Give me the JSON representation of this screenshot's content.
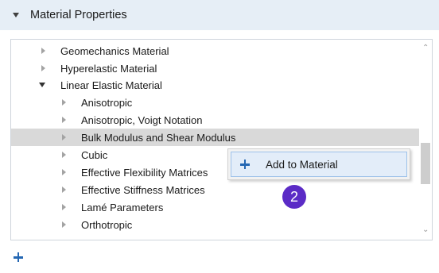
{
  "header": {
    "title": "Material Properties"
  },
  "tree": {
    "items": [
      {
        "label": "Geomechanics Material",
        "level": 0,
        "expanded": false
      },
      {
        "label": "Hyperelastic Material",
        "level": 0,
        "expanded": false
      },
      {
        "label": "Linear Elastic Material",
        "level": 0,
        "expanded": true
      },
      {
        "label": "Anisotropic",
        "level": 1,
        "expanded": false
      },
      {
        "label": "Anisotropic, Voigt Notation",
        "level": 1,
        "expanded": false
      },
      {
        "label": "Bulk Modulus and Shear Modulus",
        "level": 1,
        "expanded": false,
        "selected": true
      },
      {
        "label": "Cubic",
        "level": 1,
        "expanded": false
      },
      {
        "label": "Effective Flexibility Matrices",
        "level": 1,
        "expanded": false
      },
      {
        "label": "Effective Stiffness Matrices",
        "level": 1,
        "expanded": false
      },
      {
        "label": "Lamé Parameters",
        "level": 1,
        "expanded": false
      },
      {
        "label": "Orthotropic",
        "level": 1,
        "expanded": false
      }
    ]
  },
  "context_menu": {
    "items": [
      {
        "label": "Add to Material",
        "icon": "plus-icon"
      }
    ]
  },
  "badge": {
    "text": "2",
    "color": "#5b2bc6"
  },
  "toolbar": {
    "add_icon": "plus-icon"
  },
  "colors": {
    "header_bg": "#e6eef6",
    "accent": "#2467b3",
    "selection": "#d9d9d9"
  }
}
